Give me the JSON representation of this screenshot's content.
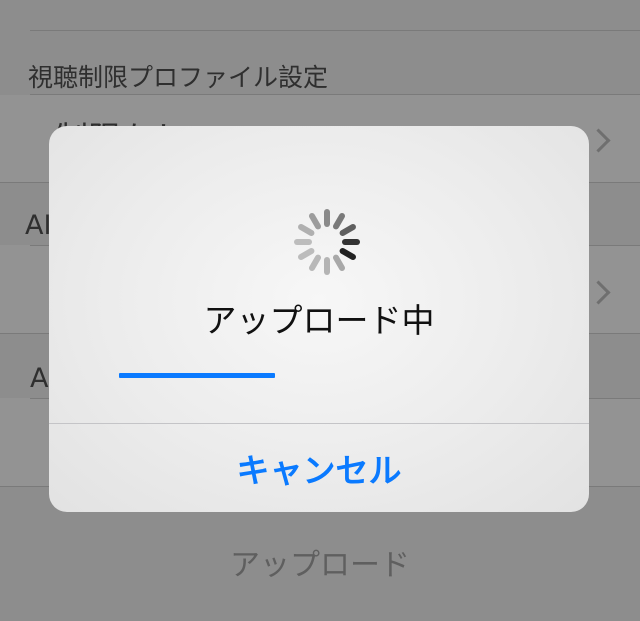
{
  "background": {
    "section_header": "視聴制限プロファイル設定",
    "row1_label": "制限なし",
    "section2_partial": "AI",
    "section3_partial": "A",
    "bottom_button": "アップロード"
  },
  "dialog": {
    "title": "アップロード中",
    "progress": 0.39,
    "cancel_label": "キャンセル",
    "accent_color": "#0a7aff",
    "spinner_icon": "activity-spinner-icon"
  }
}
